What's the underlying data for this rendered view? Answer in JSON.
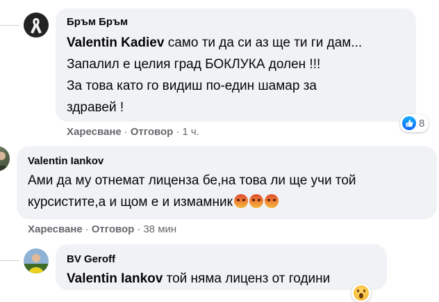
{
  "comments": [
    {
      "author": "Бръм Бръм",
      "mention": "Valentin Kadiev",
      "lines": [
        " само ти да си аз ще ти ги дам...",
        "Запалил е целия град БОКЛУКА долен !!!",
        "За това като го видиш по-един шамар за",
        "здравей !"
      ],
      "like_label": "Харесване",
      "reply_label": "Отговор",
      "time": "1 ч.",
      "reaction_count": "8"
    },
    {
      "author": "Valentin Iankov",
      "lines": [
        "Ами да му отнемат лиценза бе,на това ли ще учи той",
        "курсистите,а и щом е и измамник"
      ],
      "like_label": "Харесване",
      "reply_label": "Отговор",
      "time": "38 мин"
    },
    {
      "author": "BV Geroff",
      "mention": "Valentin Iankov",
      "text": " той няма лиценз от години"
    }
  ],
  "separator": "·",
  "colors": {
    "bubble": "#f0f2f5",
    "meta": "#65676b",
    "like": "#0866ff",
    "angry": "#e14b2f"
  }
}
